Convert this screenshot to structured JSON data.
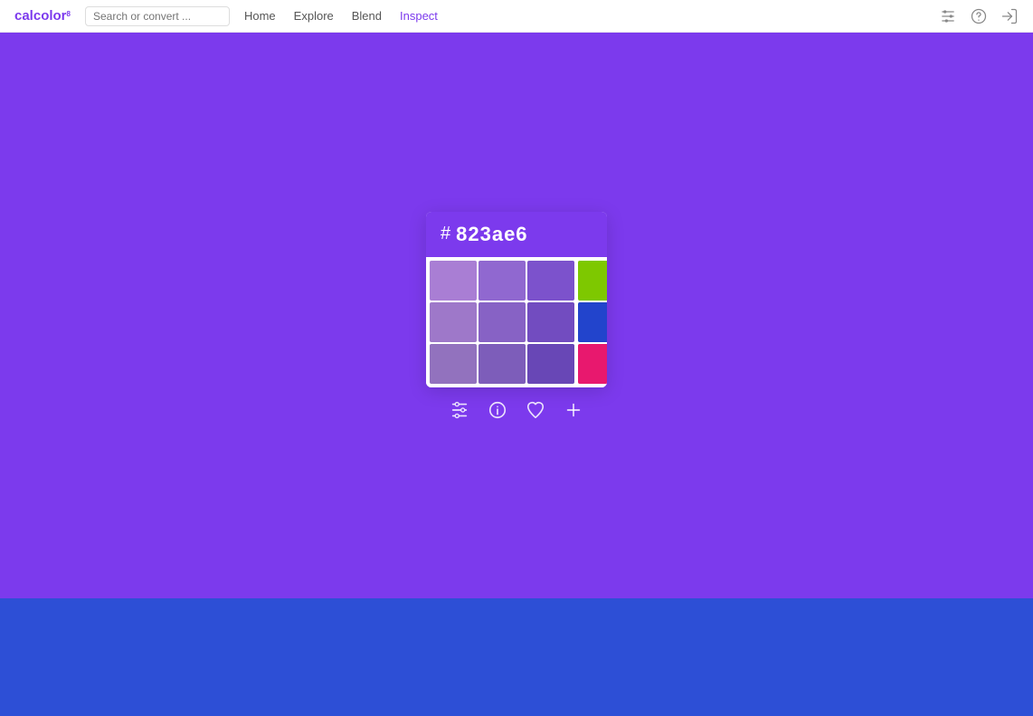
{
  "logo": {
    "text": "calcolor",
    "superscript": "8"
  },
  "search": {
    "placeholder": "Search or convert ..."
  },
  "nav": {
    "links": [
      {
        "label": "Home",
        "active": false
      },
      {
        "label": "Explore",
        "active": false
      },
      {
        "label": "Blend",
        "active": false
      },
      {
        "label": "Inspect",
        "active": true
      }
    ]
  },
  "icons": {
    "sliders": "⊞",
    "help": "?",
    "login": "→"
  },
  "card": {
    "hex_symbol": "#",
    "hex_value": "823ae6"
  },
  "palette": {
    "grid_colors": [
      "#a97ed4",
      "#9068d0",
      "#7c52cc",
      "#9e78c9",
      "#8762c5",
      "#724cc0",
      "#9272be",
      "#7d5dba",
      "#6847b6"
    ],
    "side_colors": [
      "#7ec800",
      "#2244cc",
      "#e8186e"
    ]
  },
  "action_icons": [
    {
      "name": "sliders-icon",
      "label": "Adjust"
    },
    {
      "name": "info-icon",
      "label": "Info"
    },
    {
      "name": "heart-icon",
      "label": "Favorite"
    },
    {
      "name": "add-icon",
      "label": "Add"
    }
  ]
}
